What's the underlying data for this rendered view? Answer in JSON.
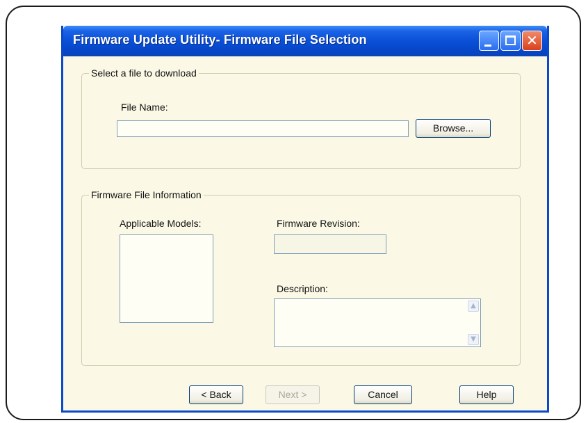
{
  "window": {
    "title": "Firmware Update Utility- Firmware File Selection",
    "minimize_glyph": "",
    "maximize_glyph": "",
    "close_glyph": "✕"
  },
  "file_group": {
    "legend": "Select a file to download",
    "file_name_label": "File Name:",
    "file_name_value": "",
    "browse_button": "Browse..."
  },
  "info_group": {
    "legend": "Firmware File Information",
    "applicable_models_label": "Applicable Models:",
    "applicable_models": [],
    "firmware_revision_label": "Firmware Revision:",
    "firmware_revision_value": "",
    "description_label": "Description:",
    "description_value": ""
  },
  "buttons": {
    "back": "< Back",
    "next": "Next >",
    "cancel": "Cancel",
    "help": "Help"
  },
  "icons": {
    "minimize": "minimize-icon",
    "maximize": "maximize-icon",
    "close": "close-icon",
    "scroll_up": "▲",
    "scroll_down": "▼"
  },
  "colors": {
    "titlebar": "#0a50d8",
    "dialog_background": "#fbf9e6",
    "close_button": "#d8411c"
  }
}
